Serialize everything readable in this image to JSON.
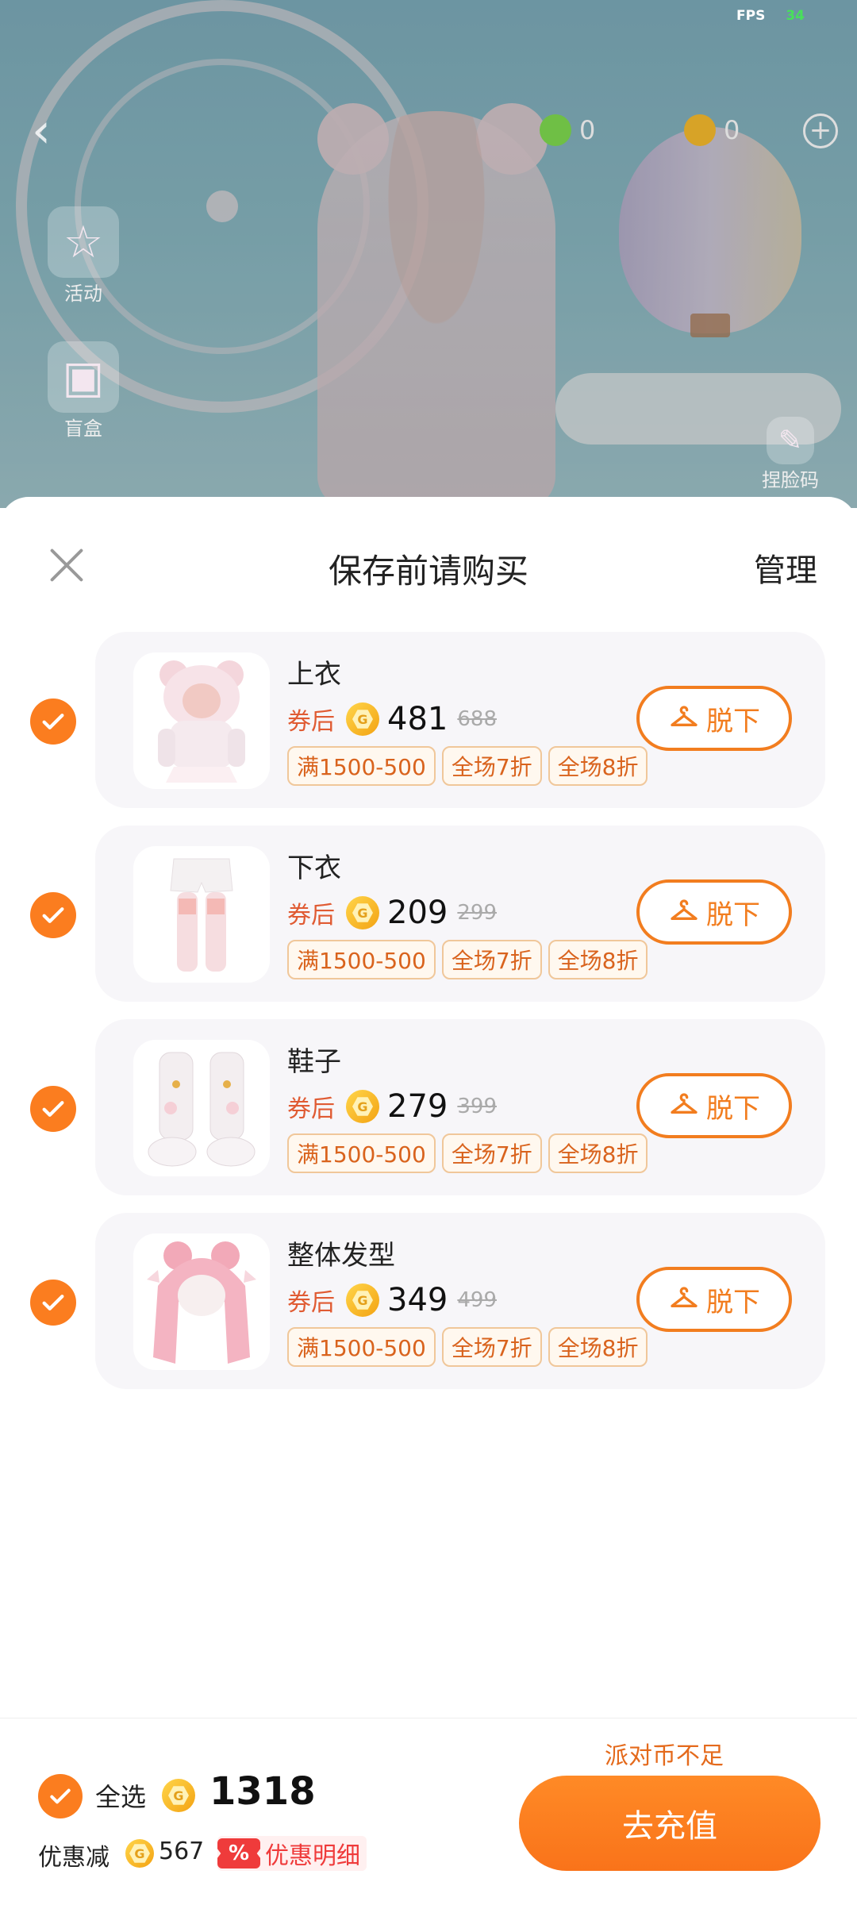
{
  "hud": {
    "fps_label": "FPS",
    "fps_value": "34",
    "currency_a": "0",
    "currency_b": "0",
    "plus": "+",
    "activity_label": "活动",
    "blindbox_label": "盲盒",
    "face_code_label": "捏脸码"
  },
  "sheet": {
    "title": "保存前请购买",
    "manage_label": "管理",
    "after_coupon_label": "券后",
    "undress_label": "脱下",
    "items": [
      {
        "name": "上衣",
        "price": "481",
        "original_price": "688",
        "tags": [
          "满1500-500",
          "全场7折",
          "全场8折"
        ],
        "checked": true,
        "thumb": "pink-bear-hoodie-top"
      },
      {
        "name": "下衣",
        "price": "209",
        "original_price": "299",
        "tags": [
          "满1500-500",
          "全场7折",
          "全场8折"
        ],
        "checked": true,
        "thumb": "white-shorts-stockings"
      },
      {
        "name": "鞋子",
        "price": "279",
        "original_price": "399",
        "tags": [
          "满1500-500",
          "全场7折",
          "全场8折"
        ],
        "checked": true,
        "thumb": "white-boots"
      },
      {
        "name": "整体发型",
        "price": "349",
        "original_price": "499",
        "tags": [
          "满1500-500",
          "全场7折",
          "全场8折"
        ],
        "checked": true,
        "thumb": "pink-long-hair"
      }
    ]
  },
  "footer": {
    "select_all_label": "全选",
    "total": "1318",
    "discount_label": "优惠减",
    "discount_value": "567",
    "discount_detail_label": "优惠明细",
    "percent_symbol": "%",
    "insufficient_label": "派对币不足",
    "recharge_label": "去充值"
  },
  "colors": {
    "accent": "#fb7d1f",
    "discount_red": "#ef3b3b",
    "coin_gold": "#f3a313"
  }
}
